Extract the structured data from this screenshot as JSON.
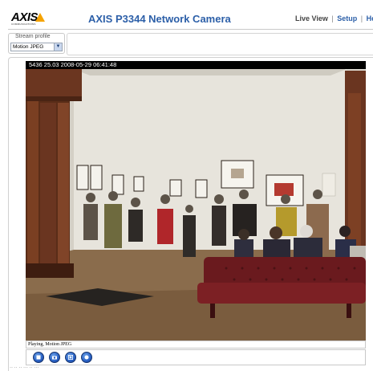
{
  "logo": {
    "wordmark": "AXIS",
    "tagline": "COMMUNICATIONS",
    "accent_color": "#f5a300"
  },
  "header": {
    "title": "AXIS P3344 Network Camera",
    "nav": {
      "live_view": "Live View",
      "separator": "|",
      "setup": "Setup",
      "help": "He"
    },
    "link_color": "#2c5fa8"
  },
  "stream_profile": {
    "label": "Stream profile",
    "selected": "Motion JPEG"
  },
  "video": {
    "overlay_text": "5436 25.03 2008-05-29 06:41:48",
    "status": "Playing, Motion JPEG"
  },
  "controls": {
    "buttons": [
      {
        "name": "stop-icon"
      },
      {
        "name": "snapshot-icon"
      },
      {
        "name": "view-full-screen-icon"
      },
      {
        "name": "record-icon"
      }
    ]
  },
  "footer": {
    "text": "·· ·· ·· ··· ·· ···"
  }
}
